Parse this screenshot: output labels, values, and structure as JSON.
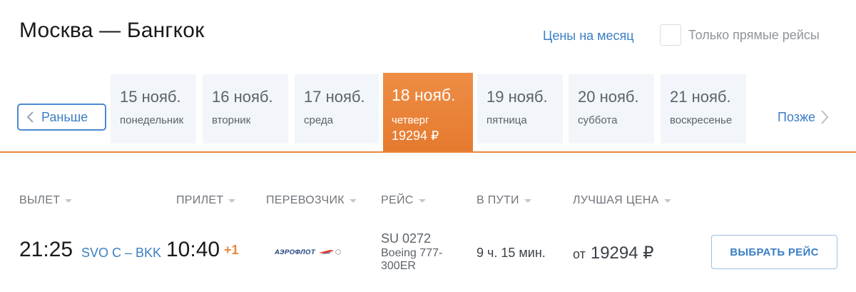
{
  "header": {
    "route_title": "Москва — Бангкок",
    "month_prices_link": "Цены на месяц",
    "direct_only": {
      "label": "Только прямые рейсы",
      "checked": false
    }
  },
  "date_nav": {
    "earlier_label": "Раньше",
    "later_label": "Позже",
    "days": [
      {
        "date": "15 нояб.",
        "weekday": "понедельник",
        "price": "",
        "active": false
      },
      {
        "date": "16 нояб.",
        "weekday": "вторник",
        "price": "",
        "active": false
      },
      {
        "date": "17 нояб.",
        "weekday": "среда",
        "price": "",
        "active": false
      },
      {
        "date": "18 нояб.",
        "weekday": "четверг",
        "price": "19294 ₽",
        "active": true
      },
      {
        "date": "19 нояб.",
        "weekday": "пятница",
        "price": "",
        "active": false
      },
      {
        "date": "20 нояб.",
        "weekday": "суббота",
        "price": "",
        "active": false
      },
      {
        "date": "21 нояб.",
        "weekday": "воскресенье",
        "price": "",
        "active": false
      }
    ]
  },
  "columns": {
    "departure": "ВЫЛЕТ",
    "arrival": "ПРИЛЕТ",
    "carrier": "ПЕРЕВОЗЧИК",
    "flight": "РЕЙС",
    "duration": "В ПУТИ",
    "best_price": "ЛУЧШАЯ ЦЕНА"
  },
  "flight": {
    "departure_time": "21:25",
    "route": "SVO C – BKK",
    "arrival_time": "10:40",
    "day_shift": "+1",
    "carrier_logo_text": "АЭРОФЛОТ",
    "flight_number": "SU 0272",
    "aircraft": "Boeing 777-300ER",
    "duration": "9 ч. 15 мин.",
    "price_prefix": "от",
    "price": "19294 ₽",
    "select_label": "ВЫБРАТЬ РЕЙС"
  },
  "colors": {
    "accent": "#e8873e",
    "link": "#3b7fc4",
    "card_bg": "#f2f6fa"
  }
}
